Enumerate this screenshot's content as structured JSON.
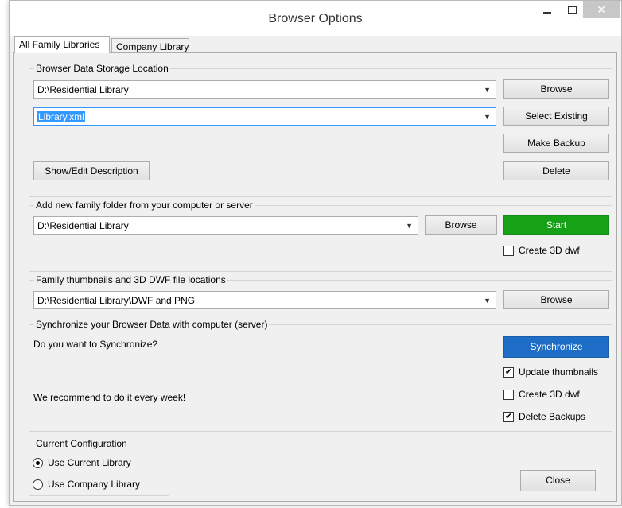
{
  "window": {
    "title": "Browser Options",
    "close_symbol": "✕"
  },
  "tabs": [
    {
      "label": "All Family Libraries",
      "active": true
    },
    {
      "label": "Company Library",
      "active": false
    }
  ],
  "storage": {
    "label": "Browser Data Storage Location",
    "path_value": "D:\\Residential Library",
    "file_value": "Library.xml",
    "browse_label": "Browse",
    "select_existing_label": "Select Existing",
    "make_backup_label": "Make Backup",
    "show_edit_label": "Show/Edit Description",
    "delete_label": "Delete"
  },
  "add_folder": {
    "label": "Add new family folder from your computer or server",
    "path_value": "D:\\Residential Library",
    "browse_label": "Browse",
    "start_label": "Start",
    "create_3d_label": "Create 3D dwf",
    "create_3d_checked": false,
    "start_color": "#17a117"
  },
  "thumbnails": {
    "label": "Family thumbnails and 3D DWF file locations",
    "path_value": "D:\\Residential Library\\DWF and PNG",
    "browse_label": "Browse"
  },
  "sync": {
    "label": "Synchronize your Browser Data with computer (server)",
    "question": "Do you want to Synchronize?",
    "recommend": "We recommend to do it every week!",
    "sync_label": "Synchronize",
    "sync_color": "#1e6dc6",
    "update_thumbnails_label": "Update thumbnails",
    "update_thumbnails_checked": true,
    "create_3d_label": "Create 3D dwf",
    "create_3d_checked": false,
    "delete_backups_label": "Delete Backups",
    "delete_backups_checked": true
  },
  "config": {
    "label": "Current Configuration",
    "use_current_label": "Use Current Library",
    "use_current_selected": true,
    "use_company_label": "Use Company Library",
    "use_company_selected": false
  },
  "close_label": "Close"
}
